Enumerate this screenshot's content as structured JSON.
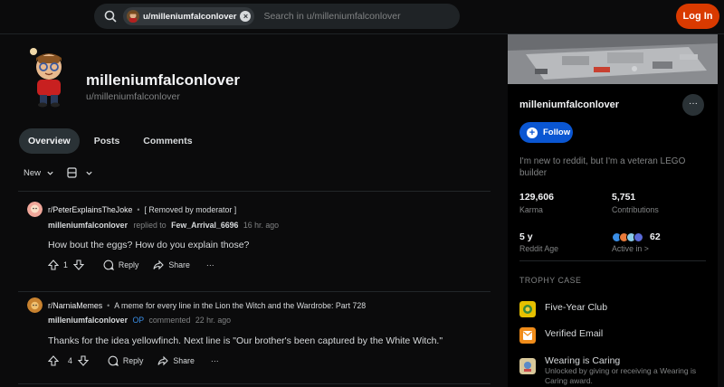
{
  "header": {
    "chip_label": "u/milleniumfalconlover",
    "search_placeholder": "Search in u/milleniumfalconlover",
    "login_label": "Log In",
    "chip_close": "×"
  },
  "profile": {
    "display_name": "milleniumfalconlover",
    "username": "u/milleniumfalconlover",
    "tabs": [
      {
        "label": "Overview",
        "active": true
      },
      {
        "label": "Posts",
        "active": false
      },
      {
        "label": "Comments",
        "active": false
      }
    ],
    "sort_label": "New"
  },
  "posts": [
    {
      "subreddit": "r/PeterExplainsTheJoke",
      "bullet": "•",
      "title": "[ Removed by moderator ]",
      "author": "milleniumfalconlover",
      "action_text": "replied to",
      "target": "Few_Arrival_6696",
      "time": "16 hr. ago",
      "body": "How bout the eggs? How do you explain those?",
      "votes": "1",
      "reply_label": "Reply",
      "share_label": "Share",
      "more_label": "···",
      "icon_color": "#f0a79a"
    },
    {
      "subreddit": "r/NarniaMemes",
      "bullet": "•",
      "title": "A meme for every line in the Lion the Witch and the Wardrobe: Part 728",
      "author": "milleniumfalconlover",
      "op_label": "OP",
      "action_text": "commented",
      "time": "22 hr. ago",
      "body": "Thanks for the idea yellowfinch. Next line is \"Our brother's been captured by the White Witch.\"",
      "votes": "4",
      "reply_label": "Reply",
      "share_label": "Share",
      "more_label": "···",
      "icon_color": "#c8822f"
    }
  ],
  "sidebar": {
    "name": "milleniumfalconlover",
    "more_label": "···",
    "follow_label": "Follow",
    "bio": "I'm new to reddit, but I'm a veteran LEGO builder",
    "stats": {
      "karma_value": "129,606",
      "karma_label": "Karma",
      "contrib_value": "5,751",
      "contrib_label": "Contributions",
      "age_value": "5 y",
      "age_label": "Reddit Age",
      "active_value": "62",
      "active_label": "Active in >"
    },
    "trophy_header": "TROPHY CASE",
    "trophies": [
      {
        "name": "Five-Year Club",
        "desc": "",
        "color": "#e6c000"
      },
      {
        "name": "Verified Email",
        "desc": "",
        "color": "#f08c1a"
      },
      {
        "name": "Wearing is Caring",
        "desc": "Unlocked by giving or receiving a Wearing is Caring award.",
        "color": "#d8c89a"
      }
    ]
  },
  "colors": {
    "accent": "#0a56d2",
    "login": "#d93a00",
    "op": "#3a8ee6"
  }
}
